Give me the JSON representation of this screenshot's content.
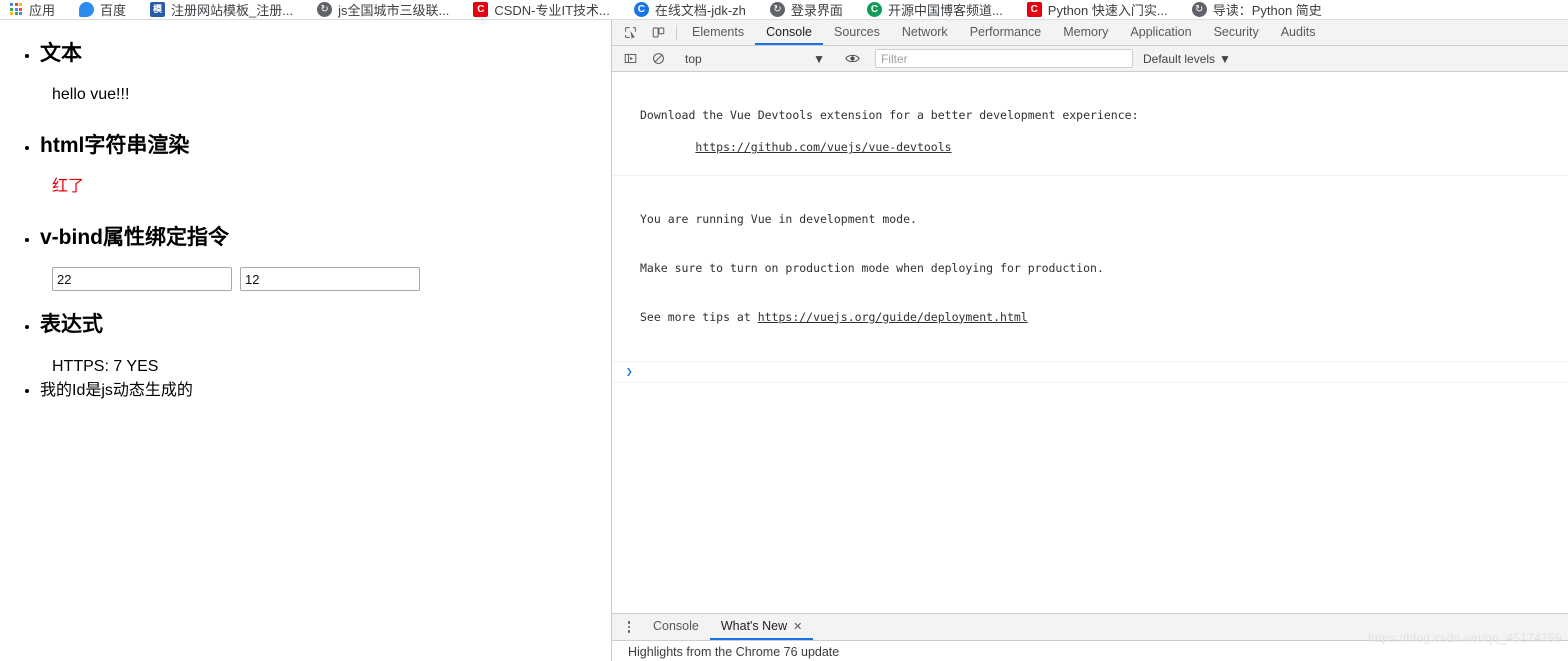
{
  "bookmarks": [
    {
      "label": "应用",
      "icon": "apps-grid-icon",
      "icon_class": "ico-apps",
      "glyph": ""
    },
    {
      "label": "百度",
      "icon": "baidu-icon",
      "icon_class": "ico-baidu",
      "glyph": ""
    },
    {
      "label": "注册网站模板_注册...",
      "icon": "site-icon",
      "icon_class": "ico-blue-sq",
      "glyph": "模"
    },
    {
      "label": "js全国城市三级联...",
      "icon": "globe-icon",
      "icon_class": "ico-gray-circ",
      "glyph": "↻"
    },
    {
      "label": "CSDN-专业IT技术...",
      "icon": "csdn-icon",
      "icon_class": "ico-red-sq",
      "glyph": "C"
    },
    {
      "label": "在线文档-jdk-zh",
      "icon": "doc-icon",
      "icon_class": "ico-blue-circ",
      "glyph": "C"
    },
    {
      "label": "登录界面",
      "icon": "globe-icon",
      "icon_class": "ico-gray-circ",
      "glyph": "↻"
    },
    {
      "label": "开源中国博客频道...",
      "icon": "oschina-icon",
      "icon_class": "ico-green-circ",
      "glyph": "C"
    },
    {
      "label": "Python 快速入门实...",
      "icon": "csdn-icon",
      "icon_class": "ico-red-sq",
      "glyph": "C"
    },
    {
      "label": "导读：Python 简史",
      "icon": "globe-icon",
      "icon_class": "ico-gray-circ",
      "glyph": "↻"
    }
  ],
  "page": {
    "sections": [
      {
        "heading": "文本",
        "body": "hello vue!!!",
        "body_color": "#000000"
      },
      {
        "heading": "html字符串渲染",
        "body": "红了",
        "body_color": "#e8000d"
      },
      {
        "heading": "v-bind属性绑定指令",
        "body": "",
        "body_color": "#000000"
      },
      {
        "heading": "表达式",
        "body": "HTTPS: 7 YES",
        "body_color": "#000000"
      }
    ],
    "inputs": [
      {
        "value": "22",
        "placeholder": ""
      },
      {
        "value": "12",
        "placeholder": ""
      }
    ],
    "last_item": "我的Id是js动态生成的"
  },
  "devtools": {
    "tabs": [
      {
        "label": "Elements",
        "active": false
      },
      {
        "label": "Console",
        "active": true
      },
      {
        "label": "Sources",
        "active": false
      },
      {
        "label": "Network",
        "active": false
      },
      {
        "label": "Performance",
        "active": false
      },
      {
        "label": "Memory",
        "active": false
      },
      {
        "label": "Application",
        "active": false
      },
      {
        "label": "Security",
        "active": false
      },
      {
        "label": "Audits",
        "active": false
      }
    ],
    "filter_bar": {
      "context": "top",
      "filter_placeholder": "Filter",
      "filter_value": "",
      "levels": "Default levels",
      "levels_caret": "▼",
      "context_caret": "▼"
    },
    "console_messages": [
      {
        "lines": [
          {
            "text": "Download the Vue Devtools extension for a better development experience:",
            "link": false
          },
          {
            "text": "https://github.com/vuejs/vue-devtools",
            "link": true
          }
        ]
      },
      {
        "lines": [
          {
            "text": "You are running Vue in development mode.",
            "link": false
          },
          {
            "text": "Make sure to turn on production mode when deploying for production.",
            "link": false
          },
          {
            "text": "See more tips at ",
            "link": false,
            "suffix_link": "https://vuejs.org/guide/deployment.html"
          }
        ]
      }
    ],
    "prompt_symbol": "❯",
    "drawer": {
      "tabs": [
        {
          "label": "Console",
          "active": false,
          "closable": false
        },
        {
          "label": "What's New",
          "active": true,
          "closable": true
        }
      ],
      "close_glyph": "✕",
      "content": "Highlights from the Chrome 76 update"
    },
    "accent_color": "#1a73e8"
  },
  "watermark": "https://blog.csdn.net/qq_45174759"
}
